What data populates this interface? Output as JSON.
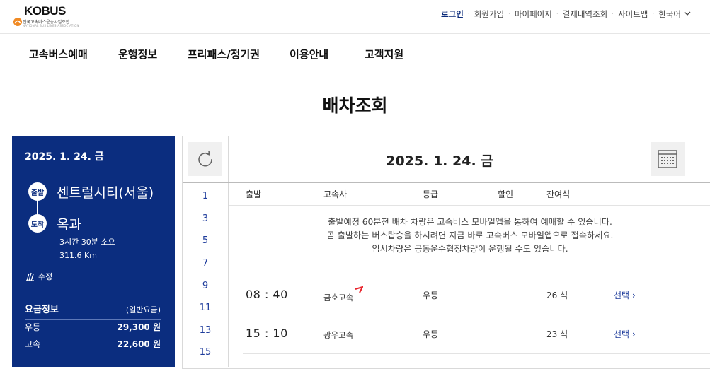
{
  "header": {
    "logo_text": "KOBUS",
    "logo_sub": "전국고속버스운송사업조합",
    "logo_sub_en": "NATIONAL BUS LINES ASSOCIATION",
    "util_links": [
      "로그인",
      "회원가입",
      "마이페이지",
      "결제내역조회",
      "사이트맵",
      "한국어"
    ]
  },
  "nav": {
    "items": [
      "고속버스예매",
      "운행정보",
      "프리패스/정기권",
      "이용안내",
      "고객지원"
    ]
  },
  "page_title": "배차조회",
  "route_panel": {
    "date": "2025. 1. 24. 금",
    "departure_badge": "출발",
    "departure": "센트럴시티(서울)",
    "arrival_badge": "도착",
    "arrival": "옥과",
    "duration": "3시간 30분 소요",
    "distance": "311.6 Km",
    "edit_label": "수정",
    "fare_title": "요금정보",
    "fare_note": "(일반요금)",
    "fares": [
      {
        "label": "우등",
        "amount": "29,300 원"
      },
      {
        "label": "고속",
        "amount": "22,600 원"
      }
    ]
  },
  "schedule": {
    "date": "2025. 1. 24. 금",
    "hours": [
      "1",
      "3",
      "5",
      "7",
      "9",
      "11",
      "13",
      "15"
    ],
    "columns": {
      "departure": "출발",
      "company": "고속사",
      "grade": "등급",
      "discount": "할인",
      "seats": "잔여석"
    },
    "notice": [
      "출발예정 60분전 배차 차량은 고속버스 모바일앱을 통하여 예매할 수 있습니다.",
      "곧 출발하는 버스탑승을 하시려면 지금 바로 고속버스 모바일앱으로 접속하세요.",
      "임시차량은 공동운수협정차량이 운행될 수도 있습니다."
    ],
    "rows": [
      {
        "time": "08 : 40",
        "company": "금호고속",
        "grade": "우등",
        "seats": "26 석",
        "action": "선택 ›"
      },
      {
        "time": "15 : 10",
        "company": "광우고속",
        "grade": "우등",
        "seats": "23 석",
        "action": "선택 ›"
      }
    ]
  },
  "colors": {
    "primary": "#0b2d7f",
    "link": "#1e3c9b",
    "kumho_accent": "#e8242c"
  }
}
